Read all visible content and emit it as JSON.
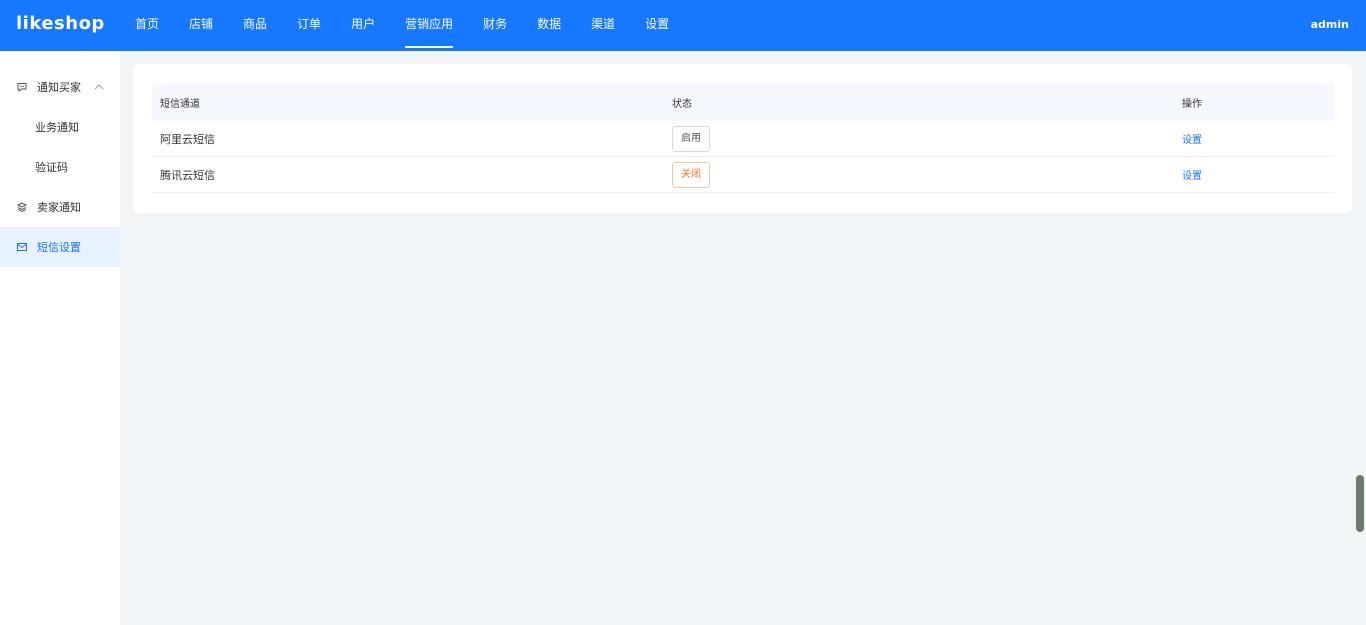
{
  "app": {
    "logo": "likeshop",
    "user": "admin"
  },
  "topnav": [
    {
      "label": "首页"
    },
    {
      "label": "店铺"
    },
    {
      "label": "商品"
    },
    {
      "label": "订单"
    },
    {
      "label": "用户"
    },
    {
      "label": "营销应用",
      "active": true
    },
    {
      "label": "财务"
    },
    {
      "label": "数据"
    },
    {
      "label": "渠道"
    },
    {
      "label": "设置"
    }
  ],
  "sidebar": {
    "group": {
      "label": "通知买家",
      "icon": "chat-bubble-icon"
    },
    "sub_items": [
      {
        "label": "业务通知"
      },
      {
        "label": "验证码"
      }
    ],
    "seller_notice": {
      "label": "卖家通知",
      "icon": "stack-icon"
    },
    "sms_settings": {
      "label": "短信设置",
      "icon": "mail-icon",
      "active": true
    }
  },
  "table": {
    "headers": [
      "短信通道",
      "状态",
      "操作"
    ],
    "rows": [
      {
        "channel": "阿里云短信",
        "status": "启用",
        "status_type": "on",
        "action": "设置"
      },
      {
        "channel": "腾讯云短信",
        "status": "关闭",
        "status_type": "off",
        "action": "设置"
      }
    ]
  },
  "colors": {
    "brand": "#1677ff",
    "off": "#e8772e"
  }
}
